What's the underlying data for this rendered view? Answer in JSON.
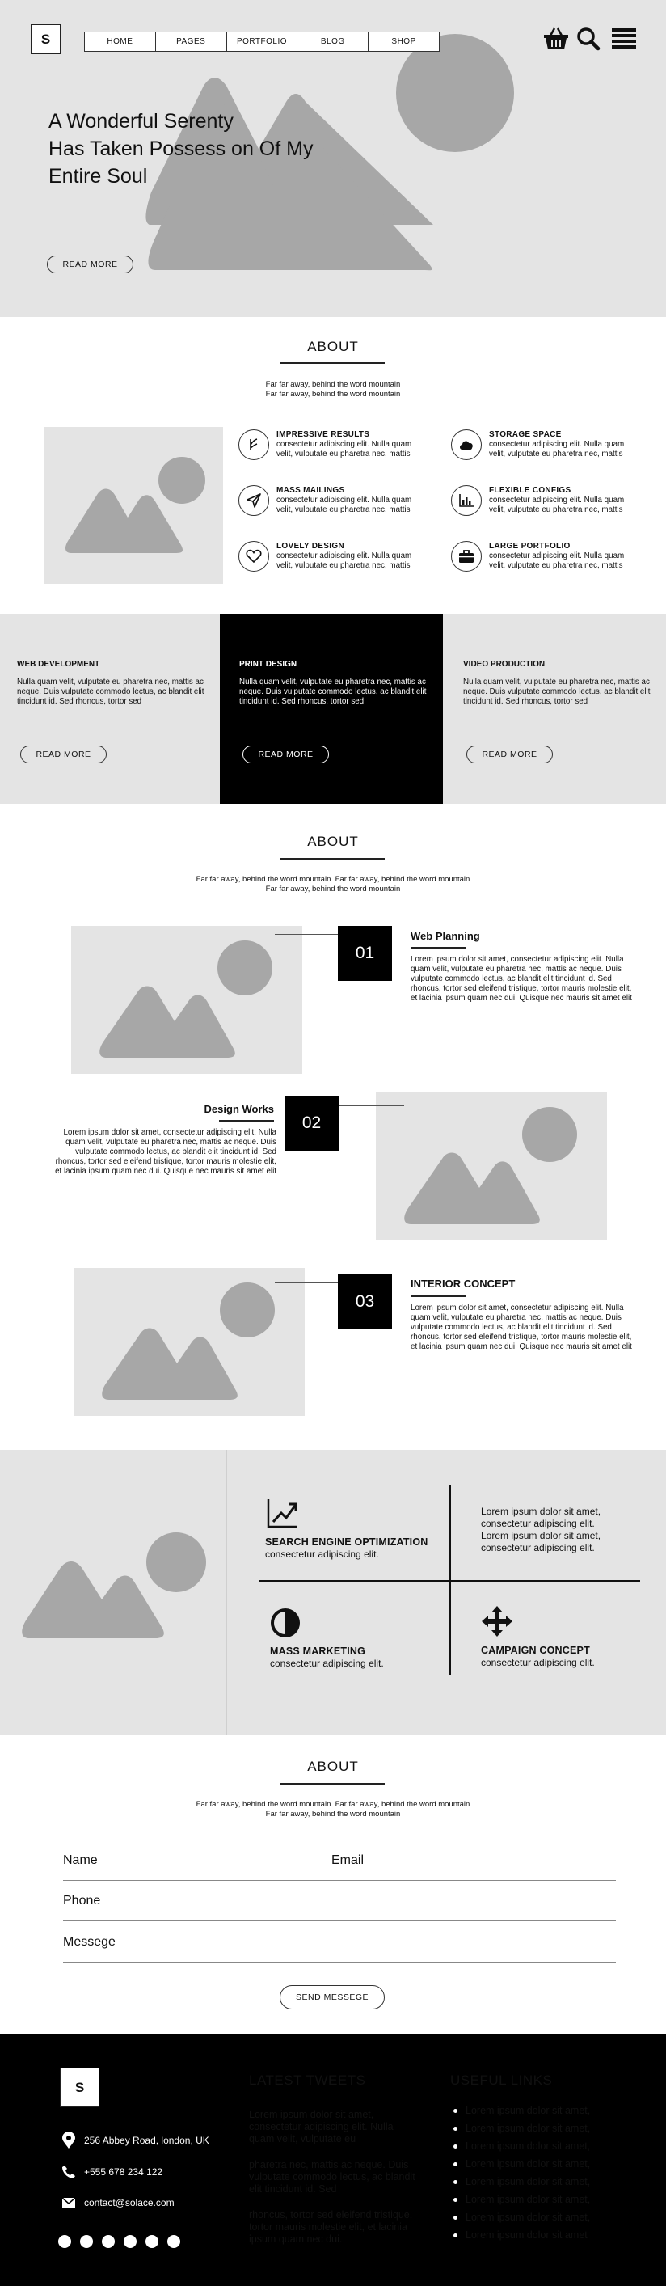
{
  "header": {
    "logo": "S",
    "nav": [
      "HOME",
      "PAGES",
      "PORTFOLIO",
      "BLOG",
      "SHOP"
    ],
    "icons": [
      "basket-icon",
      "search-icon",
      "menu-icon"
    ]
  },
  "hero": {
    "title_lines": [
      "A Wonderful Serenty",
      "Has Taken Possess on Of My",
      "Entire Soul"
    ],
    "button": "READ MORE"
  },
  "about1": {
    "title": "ABOUT",
    "sub_lines": [
      "Far far away, behind the word mountain",
      "Far far away, behind the word mountain"
    ],
    "features": [
      {
        "icon": "anchor-icon",
        "title": "IMPRESSIVE RESULTS",
        "text_lines": [
          "consectetur adipiscing elit. Nulla quam",
          "velit, vulputate eu pharetra nec, mattis"
        ]
      },
      {
        "icon": "cloud-icon",
        "title": "STORAGE SPACE",
        "text_lines": [
          "consectetur adipiscing elit. Nulla quam",
          "velit, vulputate eu pharetra nec, mattis"
        ]
      },
      {
        "icon": "paper-plane-icon",
        "title": "MASS MAILINGS",
        "text_lines": [
          "consectetur adipiscing elit. Nulla quam",
          "velit, vulputate eu pharetra nec, mattis"
        ]
      },
      {
        "icon": "bar-chart-icon",
        "title": "FLEXIBLE CONFIGS",
        "text_lines": [
          "consectetur adipiscing elit. Nulla quam",
          "velit, vulputate eu pharetra nec, mattis"
        ]
      },
      {
        "icon": "heart-icon",
        "title": "LOVELY DESIGN",
        "text_lines": [
          "consectetur adipiscing elit. Nulla quam",
          "velit, vulputate eu pharetra nec, mattis"
        ]
      },
      {
        "icon": "briefcase-icon",
        "title": "LARGE PORTFOLIO",
        "text_lines": [
          "consectetur adipiscing elit. Nulla quam",
          "velit, vulputate eu pharetra nec, mattis"
        ]
      }
    ]
  },
  "services": [
    {
      "title": "WEB DEVELOPMENT",
      "text_lines": [
        "Nulla quam velit, vulputate eu pharetra nec, mattis ac",
        "neque. Duis vulputate commodo lectus, ac blandit elit",
        "tincidunt id. Sed rhoncus, tortor sed"
      ],
      "button": "READ MORE"
    },
    {
      "title": "PRINT DESIGN",
      "text_lines": [
        "Nulla quam velit, vulputate eu pharetra nec, mattis ac",
        "neque. Duis vulputate commodo lectus, ac blandit elit",
        "tincidunt id. Sed rhoncus, tortor sed"
      ],
      "button": "READ MORE"
    },
    {
      "title": "VIDEO PRODUCTION",
      "text_lines": [
        "Nulla quam velit, vulputate eu pharetra nec, mattis ac",
        "neque. Duis vulputate commodo lectus, ac blandit elit",
        "tincidunt id. Sed rhoncus, tortor sed"
      ],
      "button": "READ MORE"
    }
  ],
  "about2": {
    "title": "ABOUT",
    "sub_lines": [
      "Far far away, behind the word mountain. Far far away, behind the word mountain",
      "Far far away, behind the word mountain"
    ],
    "steps": [
      {
        "num": "01",
        "title": "Web Planning",
        "text_lines": [
          "Lorem ipsum dolor sit amet, consectetur adipiscing elit. Nulla",
          "quam velit, vulputate eu pharetra nec, mattis ac neque. Duis",
          "vulputate commodo lectus, ac blandit elit tincidunt id. Sed",
          "rhoncus, tortor sed eleifend tristique, tortor mauris molestie elit,",
          "et lacinia ipsum quam nec dui. Quisque nec mauris sit amet elit"
        ]
      },
      {
        "num": "02",
        "title": "Design Works",
        "text_lines": [
          "Lorem ipsum dolor sit amet, consectetur adipiscing elit. Nulla",
          "quam velit, vulputate eu pharetra nec, mattis ac neque. Duis",
          "vulputate commodo lectus, ac blandit elit tincidunt id. Sed",
          "rhoncus, tortor sed eleifend tristique, tortor mauris molestie elit,",
          "et lacinia ipsum quam nec dui. Quisque nec mauris sit amet elit"
        ]
      },
      {
        "num": "03",
        "title": "INTERIOR CONCEPT",
        "text_lines": [
          "Lorem ipsum dolor sit amet, consectetur adipiscing elit. Nulla",
          "quam velit, vulputate eu pharetra nec, mattis ac neque. Duis",
          "vulputate commodo lectus, ac blandit elit tincidunt id. Sed",
          "rhoncus, tortor sed eleifend tristique, tortor mauris molestie elit,",
          "et lacinia ipsum quam nec dui. Quisque nec mauris sit amet elit"
        ]
      }
    ]
  },
  "seo": {
    "items": [
      {
        "icon": "trending-up-icon",
        "title": "SEARCH ENGINE OPTIMIZATION",
        "sub": "consectetur adipiscing elit."
      },
      {
        "lorem_lines": [
          "Lorem ipsum dolor sit amet,",
          "consectetur adipiscing elit.",
          "Lorem ipsum dolor sit amet,",
          "consectetur adipiscing elit."
        ]
      },
      {
        "icon": "contrast-icon",
        "title": "MASS MARKETING",
        "sub": "consectetur adipiscing elit."
      },
      {
        "icon": "move-arrows-icon",
        "title": "CAMPAIGN CONCEPT",
        "sub": "consectetur adipiscing elit."
      }
    ]
  },
  "about3": {
    "title": "ABOUT",
    "sub_lines": [
      "Far far away, behind the word mountain. Far far away, behind the word mountain",
      "Far far away, behind the word mountain"
    ],
    "form": {
      "name": "Name",
      "email": "Email",
      "phone": "Phone",
      "message": "Messege",
      "submit": "SEND MESSEGE"
    }
  },
  "footer": {
    "logo": "S",
    "address": "256 Abbey Road, london, UK",
    "phone": "+555 678 234 122",
    "email": "contact@solace.com",
    "social_count": 6,
    "tweets_title": "LATEST TWEETS",
    "tweets": [
      [
        "Lorem ipsum dolor sit amet,",
        "consectetur adipiscing elit. Nulla",
        "quam velit, vulputate eu"
      ],
      [
        "pharetra nec, mattis ac neque. Duis",
        "vulputate commodo lectus, ac blandit",
        "elit tincidunt id. Sed"
      ],
      [
        "rhoncus, tortor sed eleifend tristique,",
        "tortor mauris molestie elit, et lacinia",
        "ipsum quam nec dui."
      ]
    ],
    "links_title": "USEFUL LINKS",
    "links": [
      "Lorem ipsum dolor sit amet,",
      "Lorem ipsum dolor sit amet,",
      "Lorem ipsum dolor sit amet,",
      "Lorem ipsum dolor sit amet,",
      "Lorem ipsum dolor sit amet,",
      "Lorem ipsum dolor sit amet,",
      "Lorem ipsum dolor sit amet,",
      "Lorem ipsum dolor sit amet"
    ]
  },
  "colors": {
    "panel_gray": "#e4e4e4",
    "placeholder_gray": "#a7a7a7",
    "dark": "#000000",
    "white": "#ffffff"
  }
}
